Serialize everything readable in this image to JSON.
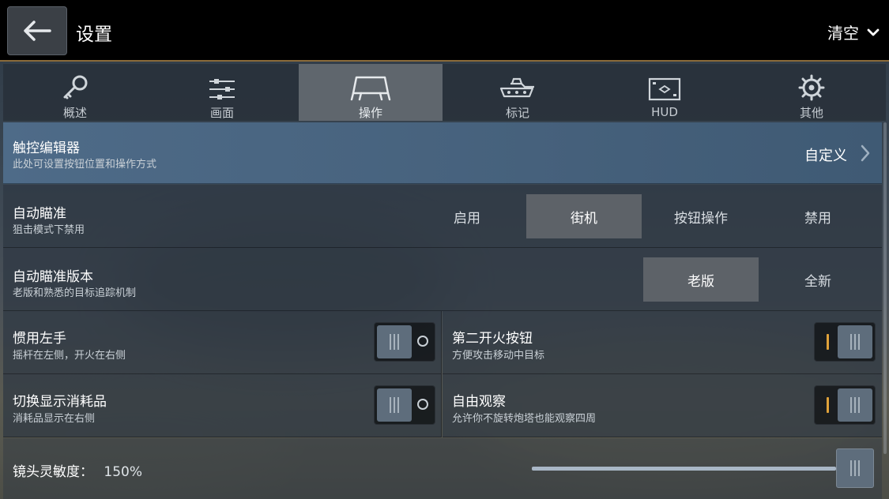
{
  "header": {
    "title": "设置",
    "clear_label": "清空"
  },
  "tabs": [
    {
      "label": "概述",
      "icon": "key-icon",
      "active": false
    },
    {
      "label": "画面",
      "icon": "sliders-icon",
      "active": false
    },
    {
      "label": "操作",
      "icon": "controller-icon",
      "active": true
    },
    {
      "label": "标记",
      "icon": "tank-icon",
      "active": false
    },
    {
      "label": "HUD",
      "icon": "hud-icon",
      "active": false
    },
    {
      "label": "其他",
      "icon": "gear-icon",
      "active": false
    }
  ],
  "touch_editor": {
    "title": "触控编辑器",
    "subtitle": "此处可设置按钮位置和操作方式",
    "value": "自定义"
  },
  "auto_aim": {
    "title": "自动瞄准",
    "subtitle": "狙击模式下禁用",
    "options": [
      "启用",
      "街机",
      "按钮操作",
      "禁用"
    ],
    "selected": "街机"
  },
  "auto_aim_version": {
    "title": "自动瞄准版本",
    "subtitle": "老版和熟悉的目标追踪机制",
    "options": [
      "老版",
      "全新"
    ],
    "selected": "老版"
  },
  "left_hand": {
    "title": "惯用左手",
    "subtitle": "摇杆在左侧，开火在右侧",
    "enabled": false
  },
  "second_fire": {
    "title": "第二开火按钮",
    "subtitle": "方便攻击移动中目标",
    "enabled": true
  },
  "show_consumables": {
    "title": "切换显示消耗品",
    "subtitle": "消耗品显示在右侧",
    "enabled": false
  },
  "free_look": {
    "title": "自由观察",
    "subtitle": "允许你不旋转炮塔也能观察四周",
    "enabled": true
  },
  "camera_sensitivity": {
    "label": "镜头灵敏度：",
    "value_text": "150%",
    "fraction": 1.0
  },
  "colors": {
    "accent": "#e0a23a",
    "active_row": "#4e6b88"
  }
}
